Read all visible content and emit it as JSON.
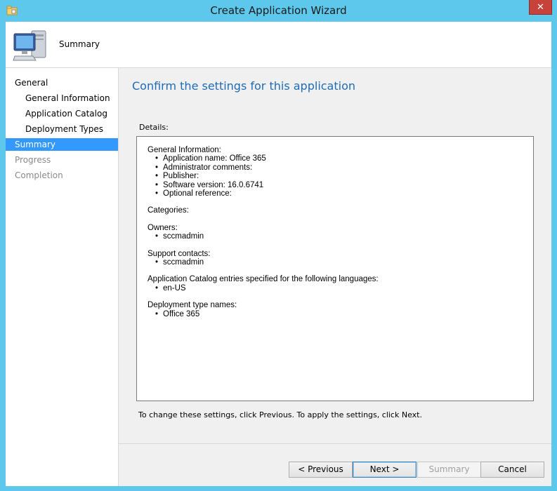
{
  "window": {
    "title": "Create Application Wizard",
    "close_glyph": "✕"
  },
  "header": {
    "title": "Summary",
    "icon": "computer-icon"
  },
  "nav": {
    "items": [
      {
        "label": "General"
      },
      {
        "label": "General Information"
      },
      {
        "label": "Application Catalog"
      },
      {
        "label": "Deployment Types"
      },
      {
        "label": "Summary"
      },
      {
        "label": "Progress"
      },
      {
        "label": "Completion"
      }
    ]
  },
  "main": {
    "heading": "Confirm the settings for this application",
    "details_label": "Details:",
    "sections": [
      {
        "title": "General Information:",
        "items": [
          "Application name: Office 365",
          "Administrator comments:",
          "Publisher:",
          "Software version: 16.0.6741",
          "Optional reference:"
        ]
      },
      {
        "title": "Categories:",
        "items": []
      },
      {
        "title": "Owners:",
        "items": [
          "sccmadmin"
        ]
      },
      {
        "title": "Support contacts:",
        "items": [
          "sccmadmin"
        ]
      },
      {
        "title": "Application Catalog entries specified for the following languages:",
        "items": [
          "en-US"
        ]
      },
      {
        "title": "Deployment type names:",
        "items": [
          "Office 365"
        ]
      }
    ],
    "hint": "To change these settings, click Previous. To apply the settings, click Next."
  },
  "buttons": {
    "previous": "< Previous",
    "next": "Next >",
    "summary": "Summary",
    "cancel": "Cancel"
  }
}
